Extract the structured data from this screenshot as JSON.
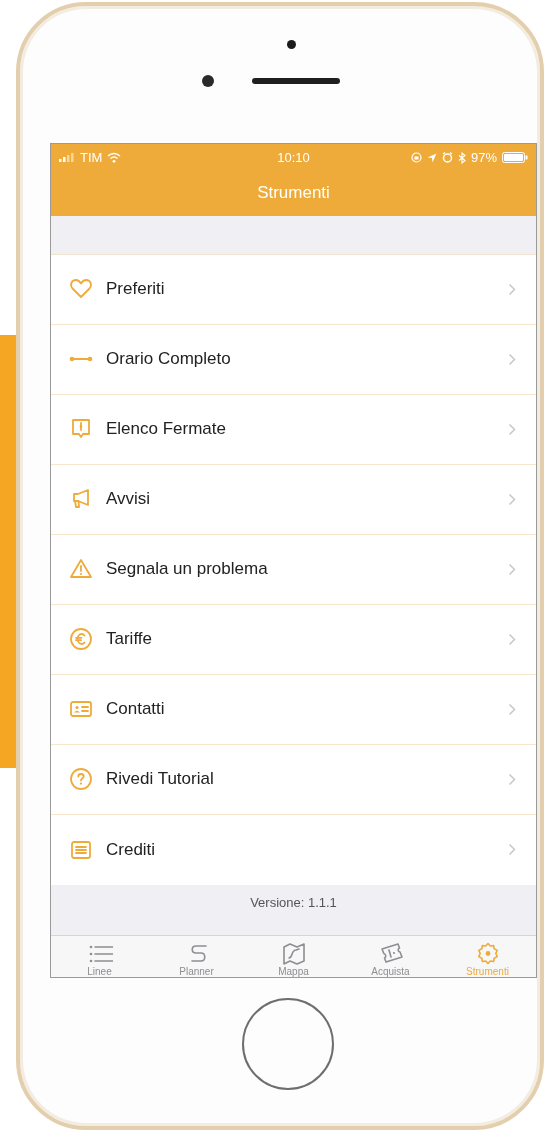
{
  "status_bar": {
    "carrier": "TIM",
    "time": "10:10",
    "battery": "97%"
  },
  "nav_bar": {
    "title": "Strumenti"
  },
  "menu": [
    {
      "label": "Preferiti"
    },
    {
      "label": "Orario Completo"
    },
    {
      "label": "Elenco Fermate"
    },
    {
      "label": "Avvisi"
    },
    {
      "label": "Segnala un problema"
    },
    {
      "label": "Tariffe"
    },
    {
      "label": "Contatti"
    },
    {
      "label": "Rivedi Tutorial"
    },
    {
      "label": "Crediti"
    }
  ],
  "version": "Versione: 1.1.1",
  "tab_bar": [
    {
      "label": "Linee",
      "selected": false
    },
    {
      "label": "Planner",
      "selected": false
    },
    {
      "label": "Mappa",
      "selected": false
    },
    {
      "label": "Acquista",
      "selected": false
    },
    {
      "label": "Strumenti",
      "selected": true
    }
  ]
}
